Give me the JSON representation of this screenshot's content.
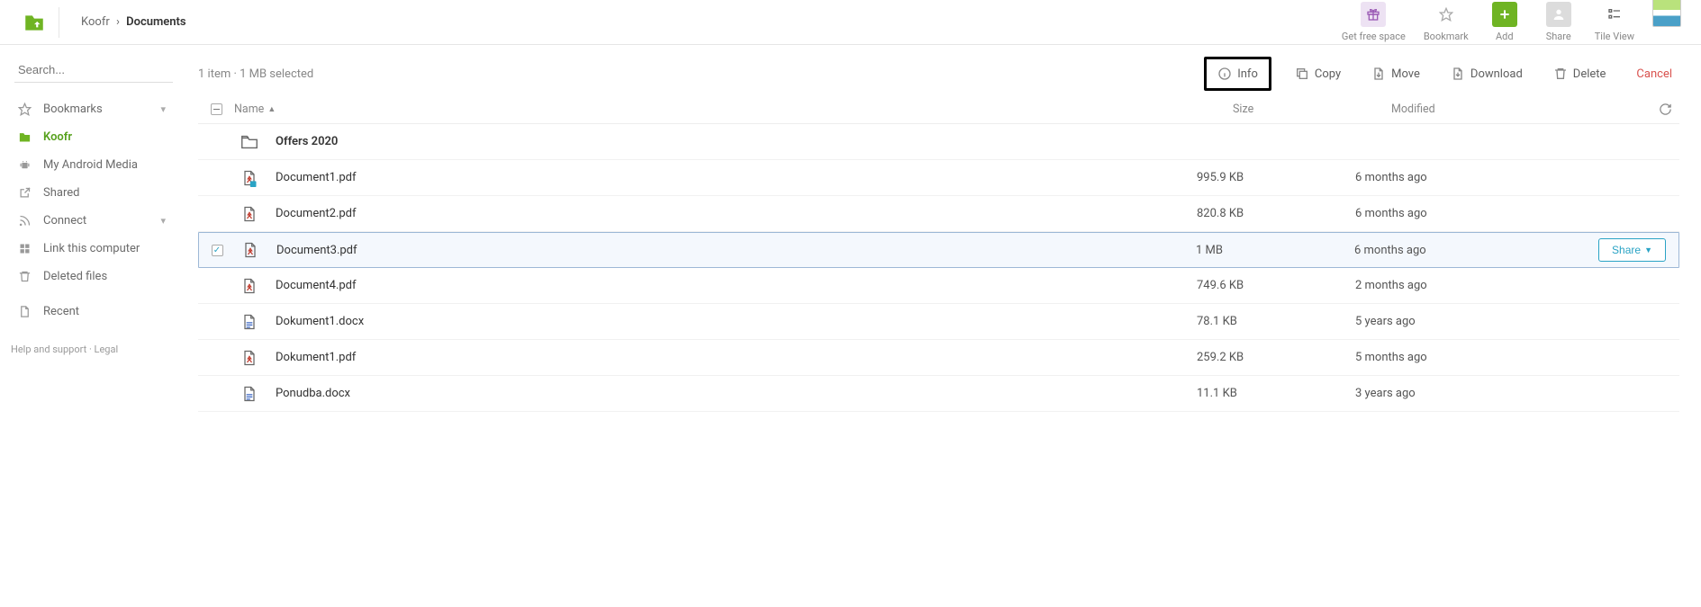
{
  "breadcrumb": {
    "root": "Koofr",
    "current": "Documents"
  },
  "topActions": {
    "getFreeSpace": "Get free space",
    "bookmark": "Bookmark",
    "add": "Add",
    "share": "Share",
    "tileView": "Tile View"
  },
  "search": {
    "placeholder": "Search..."
  },
  "sidebar": {
    "bookmarks": "Bookmarks",
    "koofr": "Koofr",
    "android": "My Android Media",
    "shared": "Shared",
    "connect": "Connect",
    "linkComputer": "Link this computer",
    "deleted": "Deleted files",
    "recent": "Recent",
    "footer": "Help and support · Legal"
  },
  "selectionText": "1 item · 1 MB selected",
  "actions": {
    "info": "Info",
    "copy": "Copy",
    "move": "Move",
    "download": "Download",
    "delete": "Delete",
    "cancel": "Cancel"
  },
  "columns": {
    "name": "Name",
    "size": "Size",
    "modified": "Modified"
  },
  "shareLabel": "Share",
  "files": [
    {
      "name": "Offers 2020",
      "size": "",
      "modified": "",
      "type": "folder"
    },
    {
      "name": "Document1.pdf",
      "size": "995.9 KB",
      "modified": "6 months ago",
      "type": "pdf-sync"
    },
    {
      "name": "Document2.pdf",
      "size": "820.8 KB",
      "modified": "6 months ago",
      "type": "pdf"
    },
    {
      "name": "Document3.pdf",
      "size": "1 MB",
      "modified": "6 months ago",
      "type": "pdf",
      "selected": true
    },
    {
      "name": "Document4.pdf",
      "size": "749.6 KB",
      "modified": "2 months ago",
      "type": "pdf"
    },
    {
      "name": "Dokument1.docx",
      "size": "78.1 KB",
      "modified": "5 years ago",
      "type": "docx"
    },
    {
      "name": "Dokument1.pdf",
      "size": "259.2 KB",
      "modified": "5 months ago",
      "type": "pdf"
    },
    {
      "name": "Ponudba.docx",
      "size": "11.1 KB",
      "modified": "3 years ago",
      "type": "docx"
    }
  ]
}
